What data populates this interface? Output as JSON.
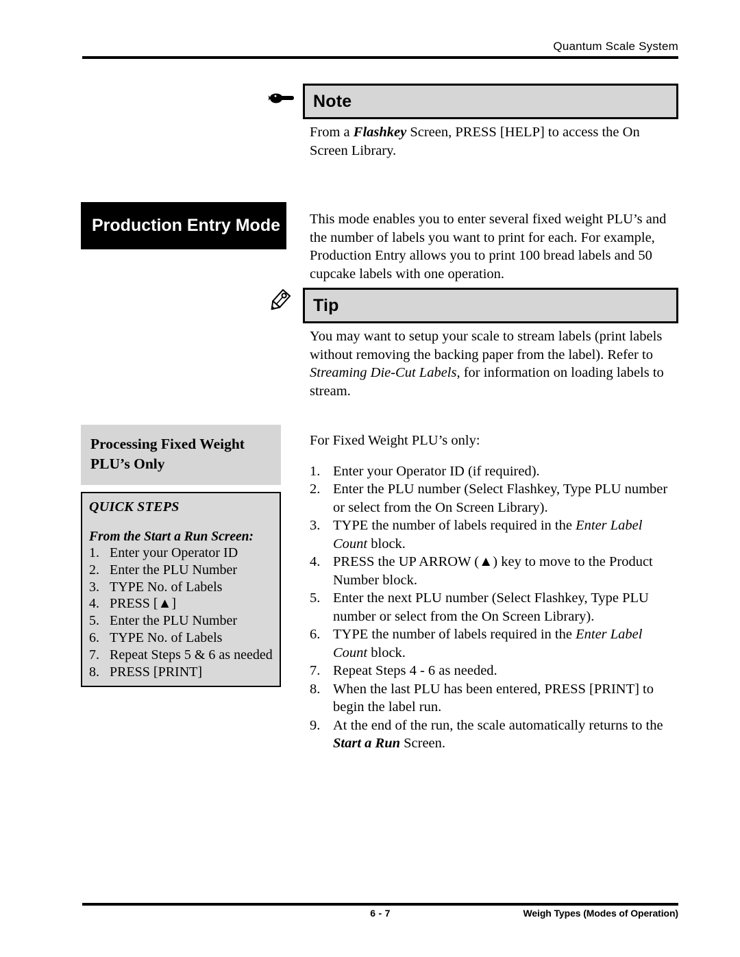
{
  "header": {
    "title": "Quantum Scale System"
  },
  "footer": {
    "page_number": "6 - 7",
    "section": "Weigh Types (Modes of Operation)"
  },
  "note_callout": {
    "icon": "pointing-hand-icon",
    "label": "Note",
    "body_prefix": "From a ",
    "body_emphasis": "Flashkey",
    "body_suffix": " Screen, PRESS [HELP] to access the On Screen Library."
  },
  "section": {
    "title": "Production Entry Mode",
    "body": "This mode enables you to enter several fixed weight PLU’s and the number of labels you want to print for each. For example, Production Entry allows you to print 100 bread labels and 50 cupcake labels with one operation."
  },
  "tip_callout": {
    "icon": "pencil-icon",
    "label": "Tip",
    "body_prefix": "You may want to setup your scale to stream labels (print labels without removing the backing paper from the label). Refer to ",
    "body_emphasis": "Streaming Die-Cut Labels",
    "body_suffix": ", for information on loading labels to stream."
  },
  "subsection": {
    "heading": "Processing Fixed Weight PLU’s Only",
    "intro": "For Fixed Weight PLU’s only:",
    "steps": [
      {
        "num": "1.",
        "text": "Enter your Operator ID (if required)."
      },
      {
        "num": "2.",
        "text": "Enter the PLU number (Select Flashkey, Type PLU number or select from the On Screen Library)."
      },
      {
        "num": "3.",
        "text": "TYPE the number of labels required in the ",
        "em": "Enter Label Count",
        "tail": " block."
      },
      {
        "num": "4.",
        "text": "PRESS the UP ARROW (▲) key to move to the Product Number block."
      },
      {
        "num": "5.",
        "text": "Enter the next PLU number (Select Flashkey, Type PLU number or select from the On Screen Library)."
      },
      {
        "num": "6.",
        "text": "TYPE the number of labels required in the ",
        "em": "Enter Label Count",
        "tail": " block."
      },
      {
        "num": "7.",
        "text": "Repeat Steps 4 - 6 as needed."
      },
      {
        "num": "8.",
        "text": "When the last PLU has been entered, PRESS [PRINT] to begin the label run."
      },
      {
        "num": "9.",
        "text": "At the end of the run, the scale automatically returns to the ",
        "emb": "Start a Run",
        "tail": " Screen."
      }
    ]
  },
  "quick_steps": {
    "title": "QUICK STEPS",
    "subtitle": "From the Start a Run Screen:",
    "items": [
      {
        "num": "1.",
        "text": "Enter your Operator ID"
      },
      {
        "num": "2.",
        "text": "Enter the PLU Number"
      },
      {
        "num": "3.",
        "text": "TYPE No. of Labels"
      },
      {
        "num": "4.",
        "text": "PRESS [▲]"
      },
      {
        "num": "5.",
        "text": "Enter the PLU Number"
      },
      {
        "num": "6.",
        "text": "TYPE No. of Labels"
      },
      {
        "num": "7.",
        "text": "Repeat Steps 5 & 6 as needed"
      },
      {
        "num": "8.",
        "text": "PRESS [PRINT]"
      }
    ]
  },
  "colors": {
    "callout_fill": "#d6d6d6",
    "black_title_fill": "#000000",
    "quick_box_fill": "#d9d9d9",
    "rule": "#000000"
  }
}
